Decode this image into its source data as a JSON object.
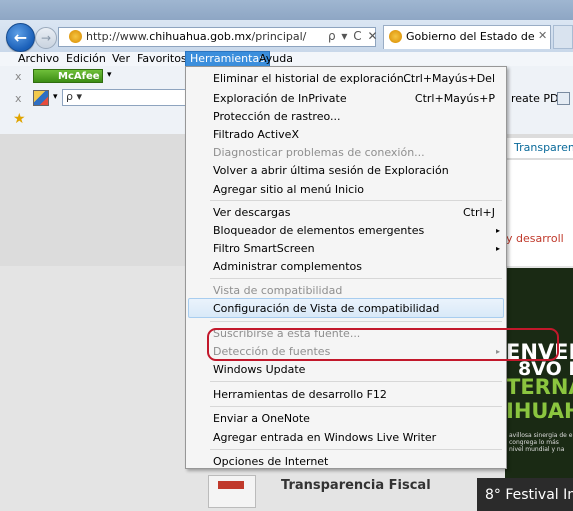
{
  "browser": {
    "address": {
      "prefix": "http://www.",
      "host": "chihuahua.gob.mx",
      "path": "/principal/"
    },
    "address_controls": "ρ ▾ C ✕",
    "tab_title": "Gobierno del Estado de Chi...",
    "tab_close": "✕"
  },
  "menubar": [
    "Archivo",
    "Edición",
    "Ver",
    "Favoritos",
    "Herramientas",
    "Ayuda"
  ],
  "toolbar": {
    "close_mark": "x",
    "mcafee_label": "McAfee",
    "dropdown_arrow": "▾",
    "search_glyph": "ρ ▾",
    "create_pdf": "reate PDF"
  },
  "page": {
    "nav_text": "Transparen",
    "red_text": "y desarroll",
    "banner_lines": [
      "ENVEN",
      "8VO F",
      "TERNA",
      "IHUAH"
    ],
    "banner_small": "avillosa sinergia de e congrega lo más nivel mundial y na",
    "fiscal": "Transparencia Fiscal",
    "festival": "8° Festival In"
  },
  "menu": {
    "items": [
      {
        "label": "Eliminar el historial de exploración...",
        "shortcut": "Ctrl+Mayús+Del",
        "disabled": false
      },
      {
        "label": "Exploración de InPrivate",
        "shortcut": "Ctrl+Mayús+P",
        "disabled": false
      },
      {
        "label": "Protección de rastreo...",
        "disabled": false
      },
      {
        "label": "Filtrado ActiveX",
        "disabled": false
      },
      {
        "label": "Diagnosticar problemas de conexión...",
        "disabled": true
      },
      {
        "label": "Volver a abrir última sesión de Exploración",
        "disabled": false
      },
      {
        "label": "Agregar sitio al menú Inicio",
        "disabled": false
      },
      {
        "label": "Ver descargas",
        "shortcut": "Ctrl+J",
        "disabled": false
      },
      {
        "label": "Bloqueador de elementos emergentes",
        "submenu": true,
        "disabled": false
      },
      {
        "label": "Filtro SmartScreen",
        "submenu": true,
        "disabled": false
      },
      {
        "label": "Administrar complementos",
        "disabled": false
      },
      {
        "label": "Vista de compatibilidad",
        "disabled": true
      },
      {
        "label": "Configuración de Vista de compatibilidad",
        "highlighted": true,
        "disabled": false
      },
      {
        "label": "Suscribirse a esta fuente...",
        "disabled": true
      },
      {
        "label": "Detección de fuentes",
        "submenu": true,
        "disabled": true
      },
      {
        "label": "Windows Update",
        "disabled": false
      },
      {
        "label": "Herramientas de desarrollo F12",
        "disabled": false
      },
      {
        "label": "Enviar a OneNote",
        "disabled": false
      },
      {
        "label": "Agregar entrada en Windows Live Writer",
        "disabled": false
      },
      {
        "label": "Opciones de Internet",
        "disabled": false
      }
    ],
    "submenu_arrow": "▸"
  },
  "colors": {
    "menu_highlight": "#3b8edc",
    "annotation": "#c2182b"
  }
}
